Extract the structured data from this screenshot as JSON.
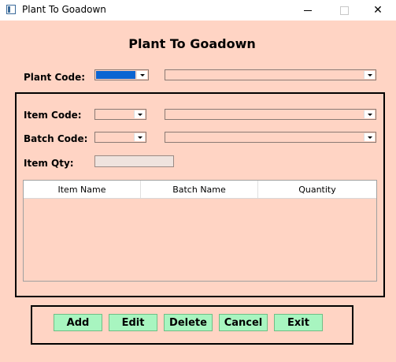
{
  "window": {
    "title": "Plant To Goadown",
    "minimize_glyph": "",
    "close_glyph": "✕"
  },
  "form": {
    "heading": "Plant To Goadown"
  },
  "plant": {
    "label": "Plant Code:",
    "code_value": "",
    "name_value": ""
  },
  "item": {
    "label": "Item Code:",
    "code_value": "",
    "name_value": ""
  },
  "batch": {
    "label": "Batch Code:",
    "code_value": "",
    "name_value": ""
  },
  "qty": {
    "label": "Item Qty:",
    "value": ""
  },
  "grid": {
    "columns": [
      "Item Name",
      "Batch Name",
      "Quantity"
    ],
    "rows": []
  },
  "buttons": {
    "add": "Add",
    "edit": "Edit",
    "delete": "Delete",
    "cancel": "Cancel",
    "exit": "Exit"
  },
  "colors": {
    "background": "#ffd4c4",
    "button_bg": "#a8f5c0",
    "selection": "#0a64d2"
  }
}
